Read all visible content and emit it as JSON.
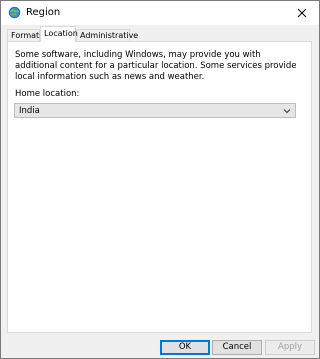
{
  "window": {
    "title": "Region"
  },
  "tabs": [
    {
      "label": "Formats"
    },
    {
      "label": "Location"
    },
    {
      "label": "Administrative"
    }
  ],
  "location": {
    "description": "Some software, including Windows, may provide you with additional content for a particular location. Some services provide local information such as news and weather.",
    "home_label": "Home location:",
    "home_value": "India"
  },
  "buttons": {
    "ok": "OK",
    "cancel": "Cancel",
    "apply": "Apply"
  },
  "icons": {
    "title": "globe-icon",
    "close": "close-icon",
    "dropdown": "chevron-down-icon"
  }
}
